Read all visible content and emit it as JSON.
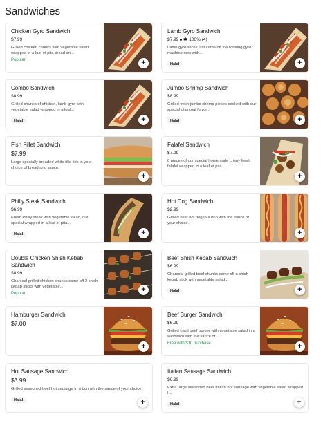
{
  "section": {
    "title": "Sandwiches"
  },
  "colors": {
    "accent_green": "#2e8b57",
    "text": "#191919",
    "muted": "#494949"
  },
  "items": [
    {
      "name": "Chicken Gyro Sandwich",
      "price": "$7.99",
      "description": "Grilled chicken chunks with vegetable salad wrapped in a loaf of pita bread an...",
      "tag": "Popular",
      "badge": "",
      "image": "gyro-wrap"
    },
    {
      "name": "Lamb Gyro Sandwich",
      "price": "$7.99",
      "rating_text": "100% (4)",
      "description": "Lamb gyro slices just came off the rotating gyro machine now with...",
      "tag": "",
      "badge": "Halal",
      "image": "gyro-wrap"
    },
    {
      "name": "Combo Sandwich",
      "price": "$8.99",
      "description": "Grilled chunks of chicken, lamb gyro with vegetable salad wrapped in a loaf...",
      "tag": "",
      "badge": "Halal",
      "image": "gyro-wrap"
    },
    {
      "name": "Jumbo Shrimp Sandwich",
      "price": "$8.99",
      "description": "Grilled fresh jumbo shrimp pieces cooked with our special charcoal flavor...",
      "tag": "",
      "badge": "Halal",
      "image": "shrimp"
    },
    {
      "name": "Fish Fillet Sandwich",
      "price": "$7.99",
      "description": "Large specially breaded white filla fish in your choice of bread and sauce.",
      "tag": "",
      "badge": "",
      "image": "sub"
    },
    {
      "name": "Falafel Sandwich",
      "price": "$7.99",
      "description": "8 pieces of our special homemade crispy fresh falafel wrapped in a loaf of pita...",
      "tag": "",
      "badge": "",
      "image": "falafel"
    },
    {
      "name": "Philly Steak Sandwich",
      "price": "$6.99",
      "description": "Fresh Philly steak with vegetable salad, our special wrapped in a loaf of pita...",
      "tag": "",
      "badge": "Halal",
      "image": "philly"
    },
    {
      "name": "Hot Dog Sandwich",
      "price": "$2.99",
      "description": "Grilled beef hot dog in a bun with the sauce of your choice.",
      "tag": "",
      "badge": "",
      "image": "hotdog"
    },
    {
      "name": "Double Chicken Shish Kebab Sandwich",
      "price": "$8.99",
      "description": "Charcoal grilled chicken chunks came off 2 shish kebab sticks with vegetable...",
      "tag": "Popular",
      "badge": "",
      "image": "kebab"
    },
    {
      "name": "Beef Shish Kebab Sandwich",
      "price": "$6.99",
      "description": "Charcoal grilled beef chunks came off a shish kebab stick with vegetable salad...",
      "tag": "",
      "badge": "Halal",
      "image": "beef-kebab"
    },
    {
      "name": "Hamburger Sandwich",
      "price": "$7.00",
      "description": "",
      "tag": "",
      "badge": "",
      "image": "burger"
    },
    {
      "name": "Beef Burger Sandwich",
      "price": "$6.99",
      "description": "Grilled halal beef burger with vegetable salad in a sandwich with the sauce of...",
      "tag": "Free with $10 purchase",
      "badge": "",
      "image": "burger"
    },
    {
      "name": "Hot Sausage Sandwich",
      "price": "$3.99",
      "description": "Grilled seasoned beef hot sausage In a bun with the sauce of your choice.",
      "tag": "",
      "badge": "Halal",
      "image": ""
    },
    {
      "name": "Italian Sausage Sandwich",
      "price": "$6.99",
      "description": "Extra large seasoned beef Italian hot sausage with vegetable salad wrapped I...",
      "tag": "",
      "badge": "Halal",
      "image": ""
    }
  ],
  "add_button_label": "+"
}
